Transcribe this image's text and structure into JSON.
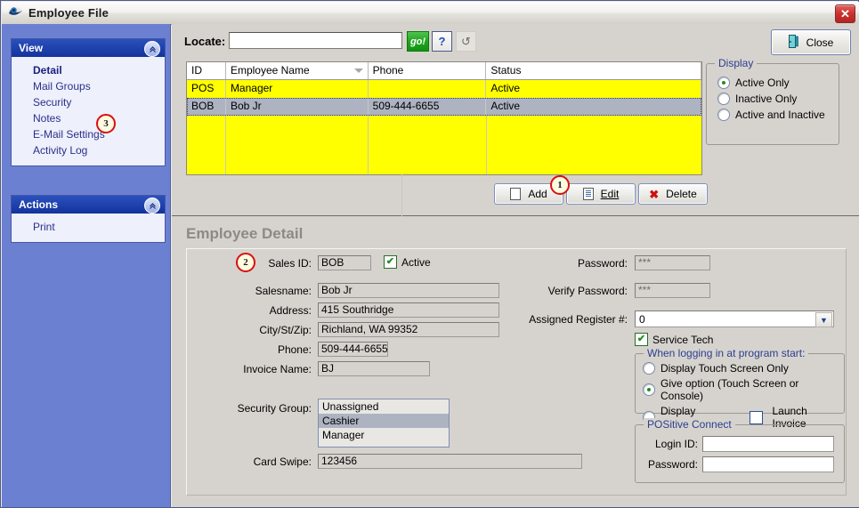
{
  "window": {
    "title": "Employee File",
    "icon": "app-logo-icon",
    "close_x": "✕"
  },
  "sidebar": {
    "panels": [
      {
        "title": "View",
        "chevron": "«",
        "items": [
          {
            "label": "Detail",
            "active": true
          },
          {
            "label": "Mail Groups",
            "active": false
          },
          {
            "label": "Security",
            "active": false
          },
          {
            "label": "Notes",
            "active": false
          },
          {
            "label": "E-Mail Settings",
            "active": false
          },
          {
            "label": "Activity Log",
            "active": false
          }
        ]
      },
      {
        "title": "Actions",
        "chevron": "«",
        "items": [
          {
            "label": "Print",
            "active": false
          }
        ]
      }
    ]
  },
  "callouts": {
    "one": "1",
    "two": "2",
    "three": "3"
  },
  "toolbar": {
    "locate_label": "Locate:",
    "locate_value": "",
    "locate_placeholder": "",
    "go_label": "go!",
    "help_label": "?",
    "refresh_label": "↺",
    "close_label": "Close",
    "close_icon": "door-exit-icon"
  },
  "grid": {
    "columns": [
      "ID",
      "Employee Name",
      "Phone",
      "Status"
    ],
    "sorted_column": "Employee Name",
    "rows": [
      {
        "id": "POS",
        "name": "Manager",
        "phone": "",
        "status": "Active",
        "selected": false
      },
      {
        "id": "BOB",
        "name": "Bob Jr",
        "phone": "509-444-6655",
        "status": "Active",
        "selected": true
      }
    ]
  },
  "display_group": {
    "title": "Display",
    "options": [
      {
        "label": "Active Only",
        "selected": true
      },
      {
        "label": "Inactive Only",
        "selected": false
      },
      {
        "label": "Active and Inactive",
        "selected": false
      }
    ]
  },
  "actions": {
    "add": "Add",
    "edit": "Edit",
    "delete": "Delete"
  },
  "detail": {
    "title": "Employee Detail",
    "fields": {
      "sales_id_label": "Sales ID:",
      "sales_id_value": "BOB",
      "active_label": "Active",
      "active_checked": "✔",
      "salesname_label": "Salesname:",
      "salesname_value": "Bob Jr",
      "address_label": "Address:",
      "address_value": "415 Southridge",
      "city_label": "City/St/Zip:",
      "city_value": "Richland, WA 99352",
      "phone_label": "Phone:",
      "phone_value": "509-444-6655",
      "invoice_name_label": "Invoice Name:",
      "invoice_name_value": "BJ",
      "security_group_label": "Security Group:",
      "card_swipe_label": "Card Swipe:",
      "card_swipe_value": "123456",
      "password_label": "Password:",
      "password_value": "***",
      "verify_password_label": "Verify Password:",
      "verify_password_value": "***",
      "assigned_register_label": "Assigned Register #:",
      "assigned_register_value": "0",
      "assigned_register_arrow": "▼",
      "service_tech_label": "Service Tech",
      "service_tech_checked": "✔"
    },
    "security_group_options": [
      {
        "label": "Unassigned",
        "selected": false
      },
      {
        "label": "Cashier",
        "selected": true
      },
      {
        "label": "Manager",
        "selected": false
      }
    ],
    "login_group": {
      "title": "When logging in at program start:",
      "options": [
        {
          "label": "Display Touch Screen Only",
          "selected": false
        },
        {
          "label": "Give option (Touch Screen or Console)",
          "selected": true
        },
        {
          "label": "Display Console",
          "selected": false
        }
      ],
      "launch_invoice_label": "Launch Invoice",
      "launch_invoice_checked": false
    },
    "positive_connect": {
      "title": "POSitive Connect",
      "login_id_label": "Login ID:",
      "login_id_value": "",
      "password_label": "Password:",
      "password_value": ""
    }
  }
}
